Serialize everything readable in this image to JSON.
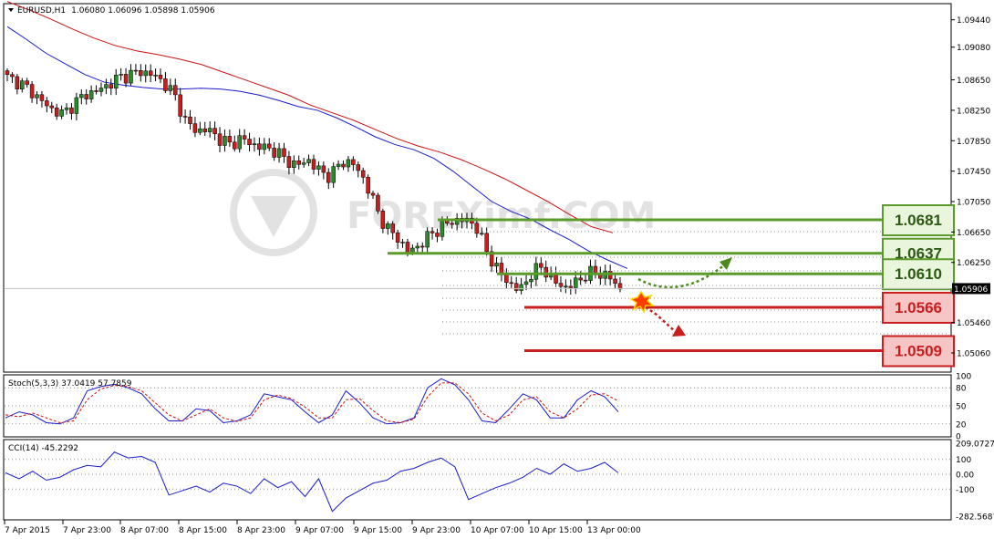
{
  "chart_data": [
    {
      "type": "candlestick",
      "title": "EURUSD,H1",
      "ohlc_header": "1.06080 1.06096 1.05898 1.05906",
      "symbol": "EURUSD",
      "timeframe": "H1",
      "last_price": "1.05906",
      "ylim": [
        1.0482,
        1.0964
      ],
      "y_ticks": [
        "1.09440",
        "1.09080",
        "1.08650",
        "1.08250",
        "1.07850",
        "1.07450",
        "1.07050",
        "1.06650",
        "1.06250",
        "1.05906",
        "1.05460",
        "1.05060"
      ],
      "x_ticks": [
        "7 Apr 2015",
        "7 Apr 23:00",
        "8 Apr 07:00",
        "8 Apr 15:00",
        "8 Apr 23:00",
        "9 Apr 07:00",
        "9 Apr 15:00",
        "9 Apr 23:00",
        "10 Apr 07:00",
        "10 Apr 15:00",
        "13 Apr 00:00"
      ],
      "close_path": [
        1.0868,
        1.0862,
        1.0852,
        1.0838,
        1.0826,
        1.082,
        1.0834,
        1.0846,
        1.085,
        1.0858,
        1.0868,
        1.0872,
        1.0876,
        1.0872,
        1.0862,
        1.0845,
        1.081,
        1.0798,
        1.08,
        1.0788,
        1.078,
        1.0788,
        1.078,
        1.0776,
        1.0772,
        1.076,
        1.0752,
        1.076,
        1.0745,
        1.0738,
        1.0758,
        1.0755,
        1.0735,
        1.07,
        1.067,
        1.0658,
        1.0638,
        1.0648,
        1.0662,
        1.0672,
        1.068,
        1.0681,
        1.0675,
        1.064,
        1.0615,
        1.0598,
        1.0588,
        1.061,
        1.062,
        1.06,
        1.0592,
        1.0598,
        1.061,
        1.0612,
        1.0606,
        1.059
      ],
      "series": [
        {
          "name": "MA fast",
          "color": "#1a1acc",
          "values": [
            1.0935,
            1.0918,
            1.09,
            1.0886,
            1.0872,
            1.0862,
            1.0858,
            1.0855,
            1.0853,
            1.0853,
            1.0854,
            1.0853,
            1.085,
            1.0845,
            1.0838,
            1.083,
            1.0825,
            1.0815,
            1.0803,
            1.079,
            1.078,
            1.0773,
            1.0762,
            1.0745,
            1.0725,
            1.0705,
            1.0692,
            1.0682,
            1.0668,
            1.0655,
            1.064,
            1.0628,
            1.0617
          ]
        },
        {
          "name": "MA slow",
          "color": "#cc1111",
          "values": [
            1.0968,
            1.0957,
            1.0945,
            1.0932,
            1.092,
            1.091,
            1.0903,
            1.0898,
            1.0892,
            1.0885,
            1.0875,
            1.0865,
            1.0855,
            1.0845,
            1.0832,
            1.0822,
            1.0812,
            1.08,
            1.0788,
            1.0778,
            1.077,
            1.076,
            1.0748,
            1.0735,
            1.072,
            1.0705,
            1.0688,
            1.0672,
            1.0664
          ]
        }
      ],
      "levels": [
        {
          "value": "1.0681",
          "kind": "resistance",
          "color": "#5a9b2a"
        },
        {
          "value": "1.0637",
          "kind": "resistance",
          "color": "#5a9b2a"
        },
        {
          "value": "1.0610",
          "kind": "resistance",
          "color": "#5a9b2a"
        },
        {
          "value": "1.0566",
          "kind": "support",
          "color": "#c81e1e"
        },
        {
          "value": "1.0509",
          "kind": "support",
          "color": "#c81e1e"
        }
      ],
      "watermark": "FOREXimf.COM"
    },
    {
      "type": "line",
      "title": "Stoch(5,3,3) 37.0419 57.7859",
      "ylim": [
        0,
        100
      ],
      "y_ticks": [
        "100",
        "80",
        "50",
        "20",
        "0"
      ],
      "series": [
        {
          "name": "%K",
          "color": "#1a1acc",
          "values": [
            30,
            40,
            35,
            22,
            20,
            30,
            75,
            82,
            86,
            80,
            70,
            45,
            25,
            25,
            45,
            42,
            22,
            25,
            35,
            70,
            65,
            60,
            40,
            22,
            35,
            75,
            55,
            30,
            20,
            22,
            30,
            80,
            95,
            85,
            60,
            25,
            22,
            45,
            70,
            60,
            30,
            30,
            60,
            75,
            65,
            40
          ]
        },
        {
          "name": "%D",
          "color": "#cc1111",
          "values": [
            35,
            32,
            38,
            30,
            22,
            25,
            60,
            78,
            84,
            82,
            75,
            55,
            35,
            25,
            35,
            45,
            30,
            24,
            30,
            60,
            68,
            62,
            48,
            30,
            30,
            60,
            62,
            42,
            25,
            22,
            28,
            65,
            88,
            88,
            70,
            38,
            25,
            35,
            60,
            65,
            40,
            30,
            45,
            68,
            70,
            58
          ]
        }
      ]
    },
    {
      "type": "line",
      "title": "CCI(14) -45.2292",
      "ylim": [
        -282.5687,
        209.0727
      ],
      "y_ticks": [
        "209.0727",
        "100",
        "0.00",
        "-100",
        "-282.5687"
      ],
      "series": [
        {
          "name": "CCI(14)",
          "color": "#1a1acc",
          "values": [
            10,
            -30,
            20,
            -40,
            -20,
            30,
            60,
            50,
            150,
            110,
            120,
            80,
            -140,
            -110,
            -80,
            -120,
            -60,
            -80,
            -130,
            -30,
            -90,
            -50,
            -150,
            -30,
            -250,
            -160,
            -110,
            -60,
            -40,
            20,
            40,
            80,
            110,
            50,
            -170,
            -130,
            -90,
            -60,
            -20,
            40,
            0,
            70,
            20,
            40,
            80,
            10
          ]
        }
      ]
    }
  ]
}
